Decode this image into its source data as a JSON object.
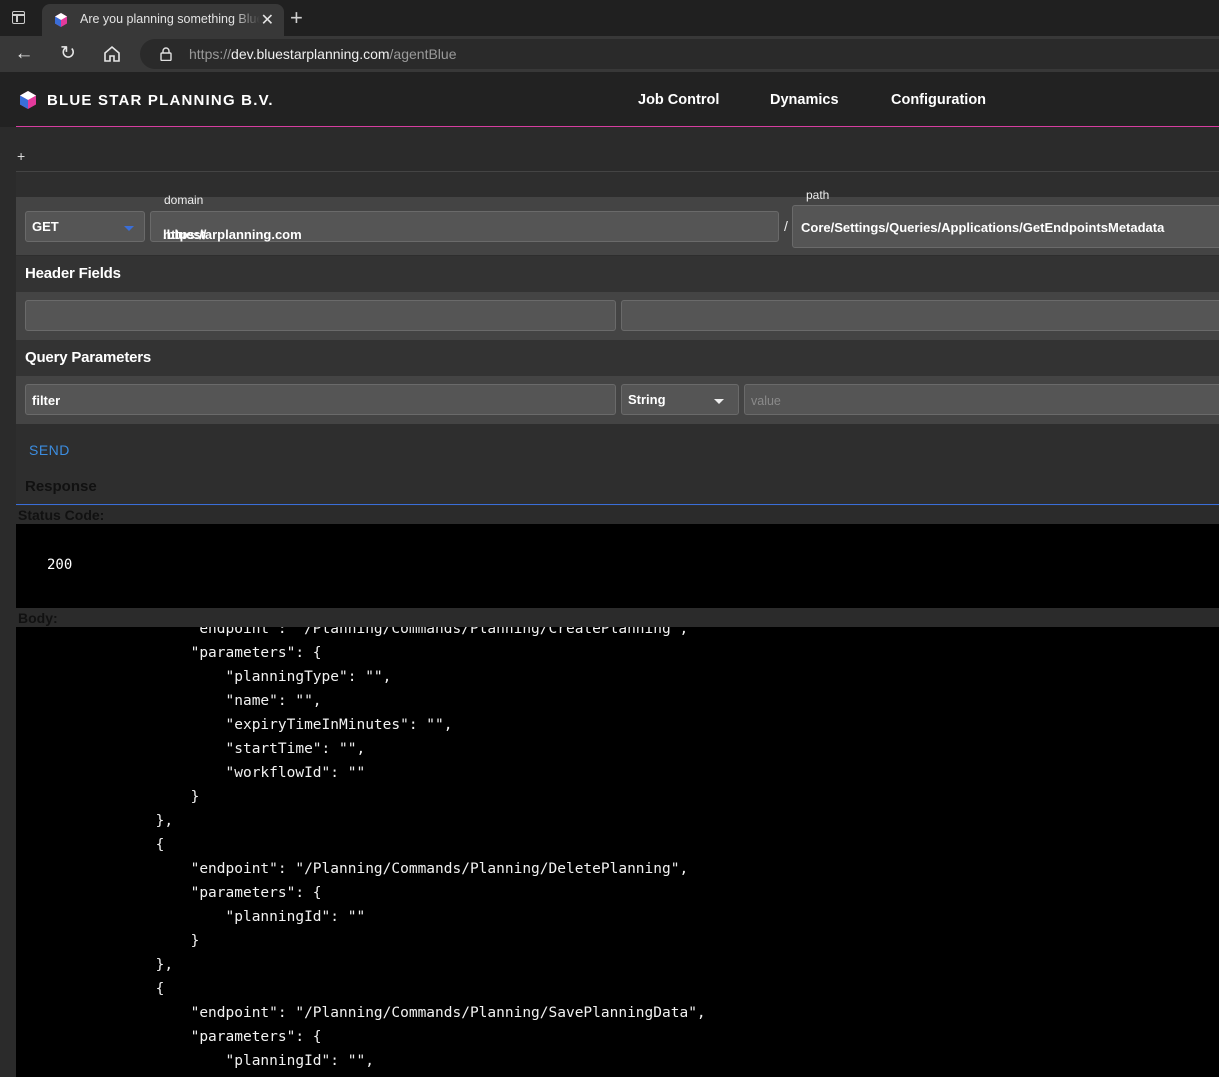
{
  "browser": {
    "tab_title": "Are you planning something Blue Star?",
    "url_scheme": "https://",
    "url_host": "dev.bluestarplanning.com",
    "url_path": "/agentBlue"
  },
  "app": {
    "brand": "BLUE STAR PLANNING B.V.",
    "menu": [
      "Job Control",
      "Dynamics",
      "Configuration"
    ],
    "add_label": "+"
  },
  "request": {
    "method": "GET",
    "domain_label": "domain",
    "domain_value_prefix": "https://",
    "domain_value_suffix": ".bluestarplanning.com",
    "separator": "/",
    "path_label": "path",
    "path_value": "Core/Settings/Queries/Applications/GetEndpointsMetadata"
  },
  "header_fields": {
    "title": "Header Fields",
    "key": "",
    "value": ""
  },
  "query_parameters": {
    "title": "Query Parameters",
    "name": "filter",
    "type": "String",
    "value_placeholder": "value"
  },
  "send_label": "SEND",
  "response": {
    "title": "Response",
    "status_label": "Status Code:",
    "status_code": "200",
    "body_label": "Body:",
    "body_lines": [
      "                    \"endpoint\": \"/Planning/Commands/Planning/CreatePlanning\",",
      "                    \"parameters\": {",
      "                        \"planningType\": \"\",",
      "                        \"name\": \"\",",
      "                        \"expiryTimeInMinutes\": \"\",",
      "                        \"startTime\": \"\",",
      "                        \"workflowId\": \"\"",
      "                    }",
      "                },",
      "                {",
      "                    \"endpoint\": \"/Planning/Commands/Planning/DeletePlanning\",",
      "                    \"parameters\": {",
      "                        \"planningId\": \"\"",
      "                    }",
      "                },",
      "                {",
      "                    \"endpoint\": \"/Planning/Commands/Planning/SavePlanningData\",",
      "                    \"parameters\": {",
      "                        \"planningId\": \"\","
    ]
  }
}
